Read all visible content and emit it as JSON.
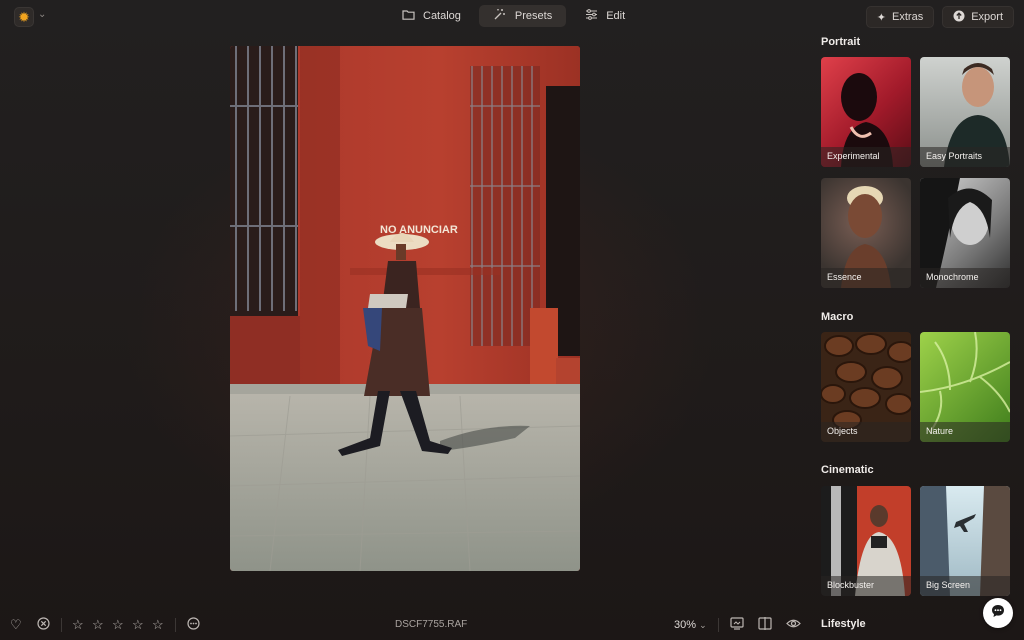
{
  "app": {
    "logo_icon": "sun-burst-icon"
  },
  "mode_tabs": [
    {
      "label": "Catalog",
      "icon": "folder-icon"
    },
    {
      "label": "Presets",
      "icon": "magic-wand-icon",
      "active": true
    },
    {
      "label": "Edit",
      "icon": "sliders-icon"
    }
  ],
  "top_actions": {
    "extras": "Extras",
    "export": "Export"
  },
  "photo": {
    "sign_text": "NO ANUNCIAR"
  },
  "sidebar": {
    "sections": [
      {
        "title": "Portrait",
        "items": [
          "Experimental",
          "Easy Portraits",
          "Essence",
          "Monochrome"
        ]
      },
      {
        "title": "Macro",
        "items": [
          "Objects",
          "Nature"
        ]
      },
      {
        "title": "Cinematic",
        "items": [
          "Blockbuster",
          "Big Screen"
        ]
      },
      {
        "title": "Lifestyle",
        "items": []
      }
    ]
  },
  "bottom_bar": {
    "filename": "DSCF7755.RAF",
    "zoom": "30%",
    "rating": 0,
    "max_rating": 5
  },
  "colors": {
    "accent": "#f2a51f",
    "wall": "#b23a2c"
  }
}
